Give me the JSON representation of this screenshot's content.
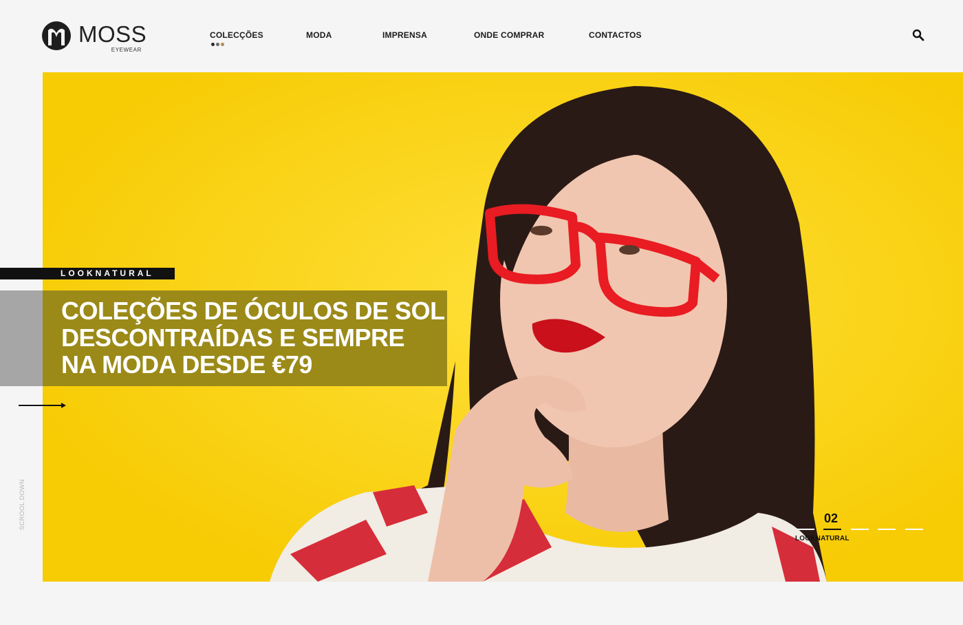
{
  "brand": {
    "name": "MOSS",
    "sub": "EYEWEAR"
  },
  "nav": {
    "items": [
      {
        "label": "COLECÇÕES"
      },
      {
        "label": "MODA"
      },
      {
        "label": "IMPRENSA"
      },
      {
        "label": "ONDE COMPRAR"
      },
      {
        "label": "CONTACTOS"
      }
    ],
    "active_dots": [
      "#2b2b2b",
      "#6b6b6b",
      "#b18b52"
    ]
  },
  "hero": {
    "tag": "LOOKNATURAL",
    "headline": [
      "COLEÇÕES DE ÓCULOS DE SOL",
      "DESCONTRAÍDAS E SEMPRE",
      "NA MODA DESDE €79"
    ],
    "background_color": "#fbd40f",
    "accent_color": "#9b8a18"
  },
  "scroll_label": "SCROOL DOWN",
  "slider": {
    "current": "02",
    "label": "LOOKNATURAL",
    "total_dashes": 5
  },
  "icons": {
    "search": "search-icon",
    "arrow": "arrow-right-icon",
    "logo": "moss-logo-icon"
  }
}
